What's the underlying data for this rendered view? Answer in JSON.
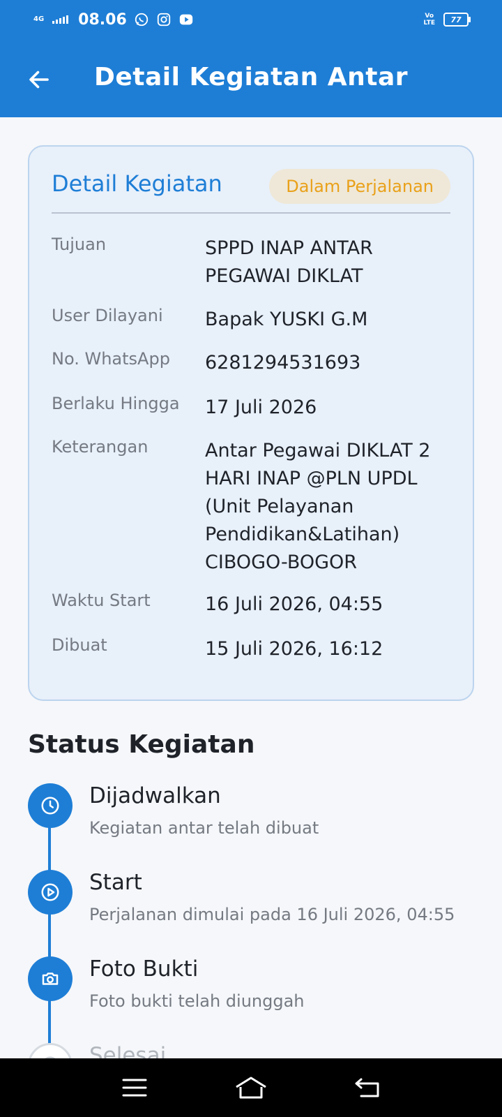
{
  "status_bar": {
    "network": "4G",
    "time": "08.06",
    "volte_line1": "Vo",
    "volte_line2": "LTE",
    "battery": "77"
  },
  "appbar": {
    "title": "Detail Kegiatan Antar"
  },
  "detail_card": {
    "title": "Detail Kegiatan",
    "status_badge": "Dalam Perjalanan",
    "rows": [
      {
        "label": "Tujuan",
        "value": "SPPD INAP ANTAR PEGAWAI DIKLAT"
      },
      {
        "label": "User Dilayani",
        "value": "Bapak YUSKI G.M"
      },
      {
        "label": "No. WhatsApp",
        "value": "6281294531693"
      },
      {
        "label": "Berlaku Hingga",
        "value": "17 Juli 2026"
      },
      {
        "label": "Keterangan",
        "value": "Antar Pegawai DIKLAT 2 HARI INAP @PLN UPDL (Unit Pelayanan Pendidikan&Latihan) CIBOGO-BOGOR"
      },
      {
        "label": "Waktu Start",
        "value": "16 Juli 2026, 04:55"
      },
      {
        "label": "Dibuat",
        "value": "15 Juli 2026, 16:12"
      }
    ]
  },
  "status_section": {
    "title": "Status Kegiatan",
    "steps": [
      {
        "title": "Dijadwalkan",
        "desc": "Kegiatan antar telah dibuat",
        "icon": "clock-icon"
      },
      {
        "title": "Start",
        "desc": "Perjalanan dimulai pada 16 Juli 2026, 04:55",
        "icon": "play-icon"
      },
      {
        "title": "Foto Bukti",
        "desc": "Foto bukti telah diunggah",
        "icon": "camera-icon"
      },
      {
        "title": "Selesai",
        "desc": "",
        "icon": "check-icon"
      }
    ]
  },
  "colors": {
    "primary": "#1e7ed6",
    "badge_text": "#e9a11a",
    "badge_bg": "#efe8d8",
    "card_bg": "#e8f0fa"
  }
}
